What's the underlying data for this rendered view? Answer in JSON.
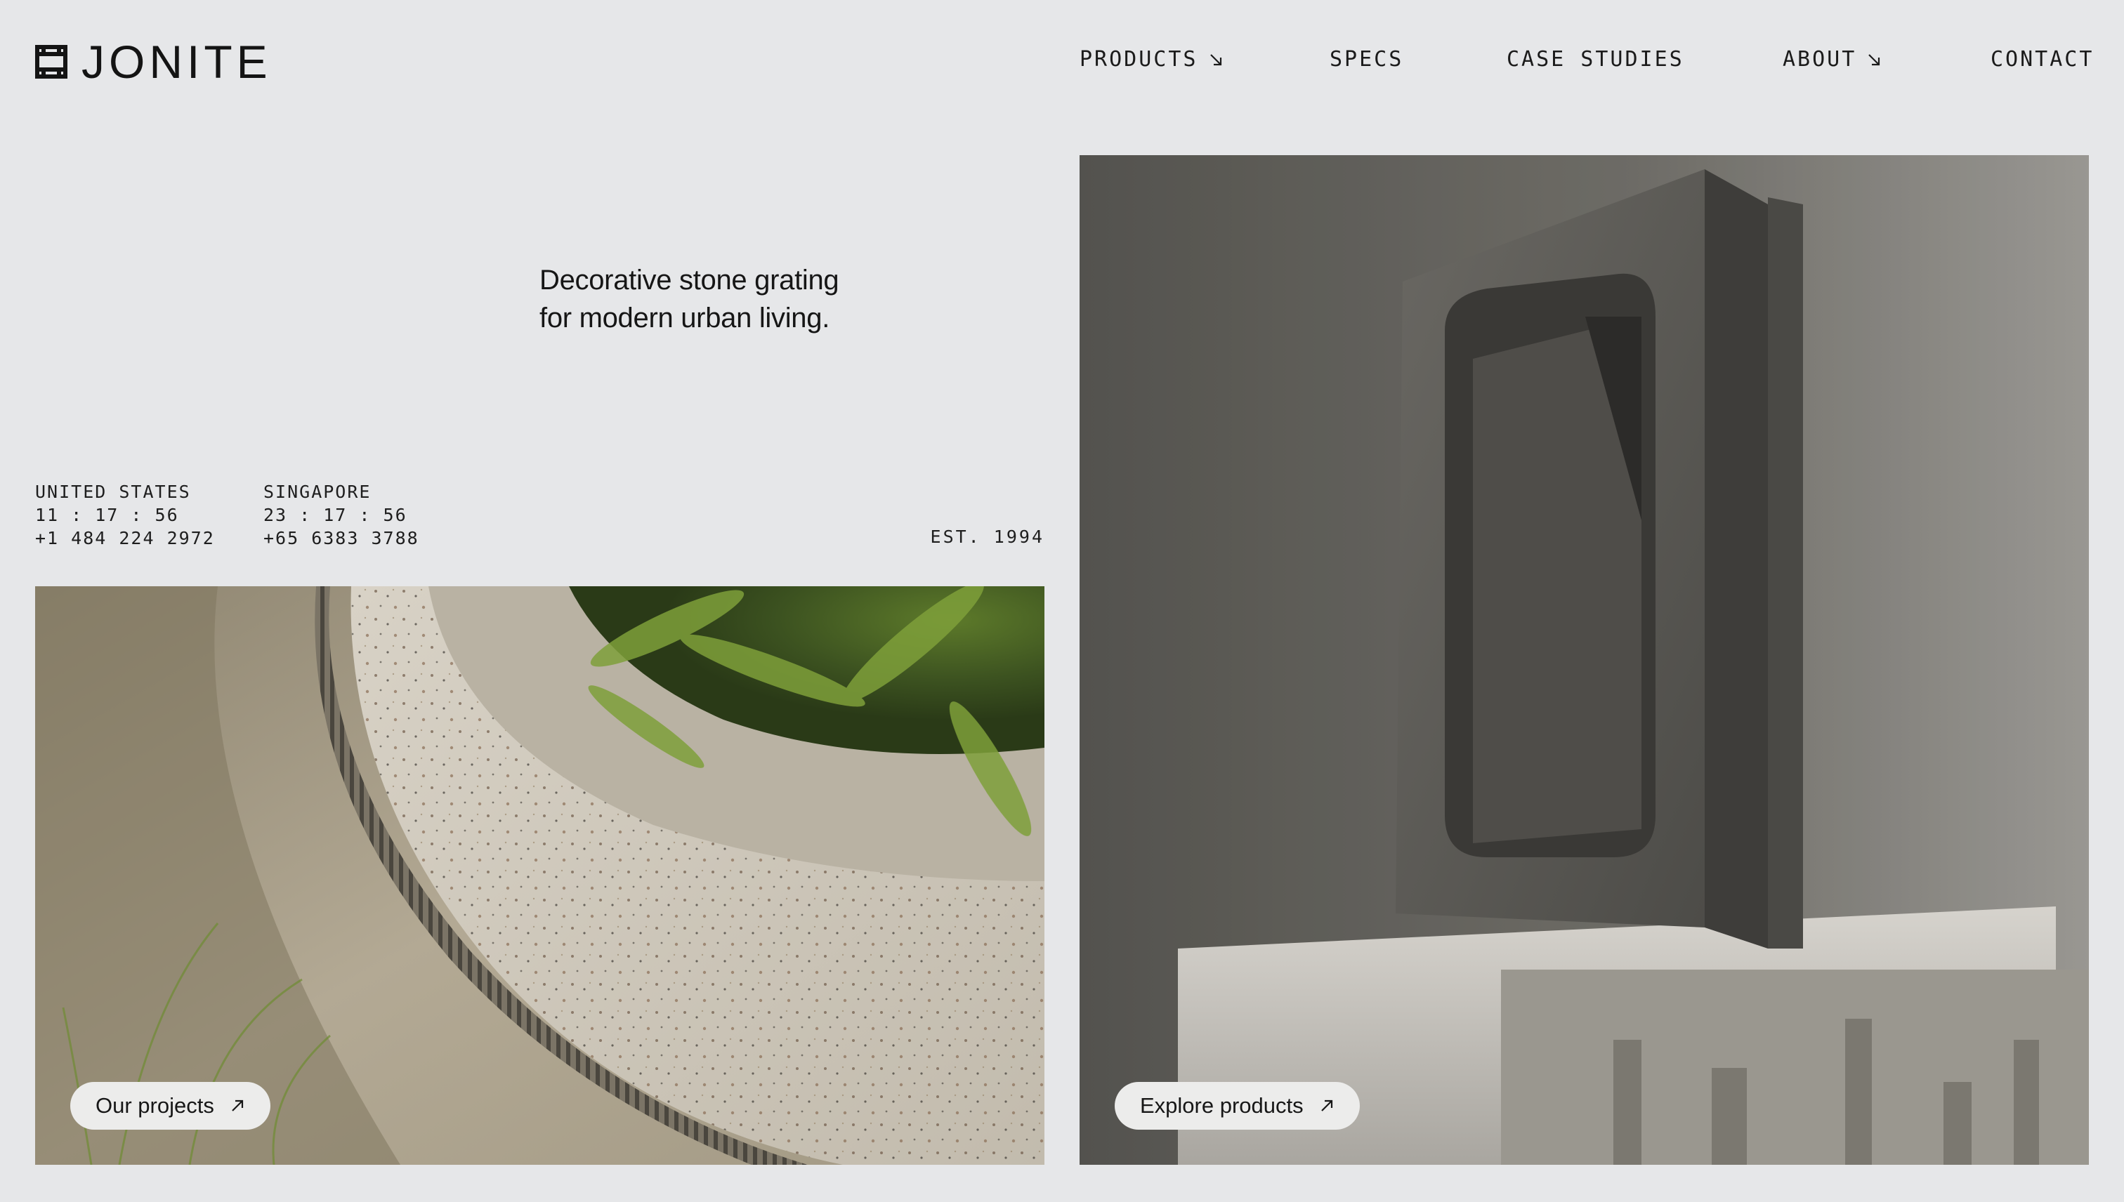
{
  "brand": {
    "name": "JONITE"
  },
  "nav": {
    "products": "PRODUCTS",
    "specs": "SPECS",
    "case_studies": "CASE STUDIES",
    "about": "ABOUT",
    "contact": "CONTACT"
  },
  "hero": {
    "tagline_line1": "Decorative stone grating",
    "tagline_line2": "for modern urban living."
  },
  "locations": [
    {
      "country": "UNITED STATES",
      "time": "11 : 17 : 56",
      "phone": "+1 484 224 2972"
    },
    {
      "country": "SINGAPORE",
      "time": "23 : 17 : 56",
      "phone": "+65 6383 3788"
    }
  ],
  "established": "EST. 1994",
  "ctas": {
    "projects": "Our projects",
    "products": "Explore products"
  },
  "colors": {
    "background": "#e6e7e9",
    "text": "#1c1c1c",
    "button_bg": "#ececeb"
  },
  "icons": {
    "logo": "jonite-logo-icon",
    "nav_dropdown": "arrow-down-right-icon",
    "cta": "arrow-up-right-icon"
  }
}
